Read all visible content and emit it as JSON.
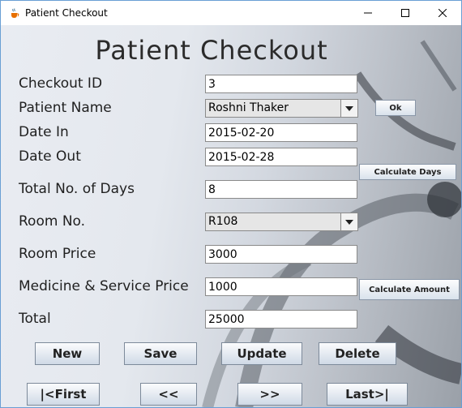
{
  "window": {
    "title": "Patient Checkout"
  },
  "heading": "Patient Checkout",
  "form": {
    "checkout_id": {
      "label": "Checkout ID",
      "value": "3"
    },
    "patient_name": {
      "label": "Patient Name",
      "value": "Roshni Thaker"
    },
    "date_in": {
      "label": "Date In",
      "value": "2015-02-20"
    },
    "date_out": {
      "label": "Date Out",
      "value": "2015-02-28"
    },
    "total_days": {
      "label": "Total No. of Days",
      "value": "8"
    },
    "room_no": {
      "label": "Room No.",
      "value": "R108"
    },
    "room_price": {
      "label": "Room Price",
      "value": "3000"
    },
    "medicine_price": {
      "label": "Medicine & Service Price",
      "value": "1000"
    },
    "total": {
      "label": "Total",
      "value": "25000"
    }
  },
  "buttons": {
    "ok": "Ok",
    "calculate_days": "Calculate Days",
    "calculate_amount": "Calculate Amount",
    "new": "New",
    "save": "Save",
    "update": "Update",
    "delete": "Delete",
    "first": "|<First",
    "prev": "<<",
    "next": ">>",
    "last": "Last>|"
  },
  "icons": {
    "app": "java-cup-icon",
    "minimize": "minimize-icon",
    "maximize": "maximize-icon",
    "close": "close-icon",
    "dropdown": "chevron-down-icon"
  }
}
